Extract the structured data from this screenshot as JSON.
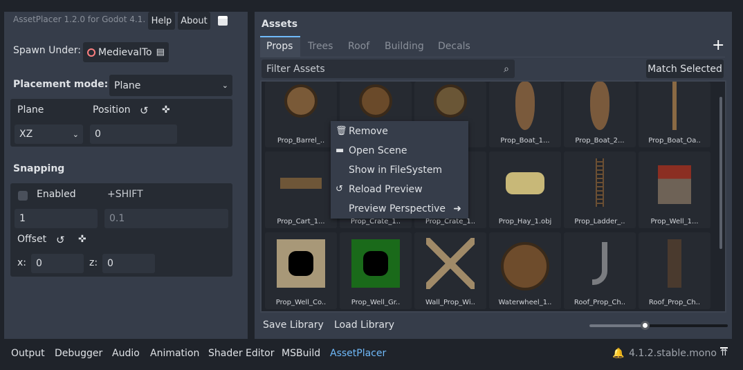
{
  "header": {
    "version": "AssetPlacer 1.2.0 for Godot 4.1.",
    "help": "Help",
    "about": "About"
  },
  "spawn": {
    "label": "Spawn Under:",
    "node": "MedievalTo"
  },
  "placement": {
    "label": "Placement mode:",
    "mode": "Plane",
    "plane_label": "Plane",
    "position_label": "Position",
    "plane_value": "XZ",
    "position_value": "0"
  },
  "snapping": {
    "title": "Snapping",
    "enabled_label": "Enabled",
    "enabled": false,
    "shift_label": "+SHIFT",
    "snap_value": "1",
    "shift_value": "0.1",
    "offset_label": "Offset",
    "x_label": "x:",
    "x_value": "0",
    "z_label": "z:",
    "z_value": "0"
  },
  "assets": {
    "title": "Assets",
    "tabs": [
      "Props",
      "Trees",
      "Roof",
      "Building",
      "Decals"
    ],
    "active_tab": "Props",
    "filter_placeholder": "Filter Assets",
    "match_selected": "Match Selected",
    "items": [
      "Prop_Barrel_..",
      "",
      "",
      "Prop_Boat_1...",
      "Prop_Boat_2...",
      "Prop_Boat_Oa..",
      "Prop_Cart_1...",
      "Prop_Crate_1..",
      "Prop_Crate_1..",
      "Prop_Hay_1.obj",
      "Prop_Ladder_..",
      "Prop_Well_1...",
      "Prop_Well_Co..",
      "Prop_Well_Gr..",
      "Wall_Prop_Wi..",
      "Waterwheel_1..",
      "Roof_Prop_Ch..",
      "Roof_Prop_Ch.."
    ],
    "save_library": "Save Library",
    "load_library": "Load Library",
    "thumbnail_size_fraction": 0.4
  },
  "context_menu": {
    "items": [
      "Remove",
      "Open Scene",
      "Show in FileSystem",
      "Reload Preview",
      "Preview Perspective"
    ]
  },
  "bottom_tabs": [
    "Output",
    "Debugger",
    "Audio",
    "Animation",
    "Shader Editor",
    "MSBuild",
    "AssetPlacer"
  ],
  "active_bottom_tab": "AssetPlacer",
  "version": "4.1.2.stable.mono",
  "colors": {
    "accent": "#70bafa",
    "panel": "#363d4a",
    "node_icon": "#fc7f7f"
  }
}
